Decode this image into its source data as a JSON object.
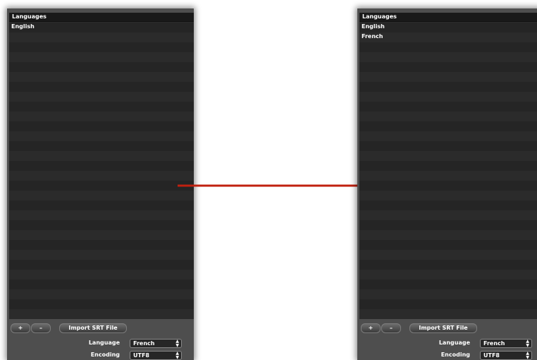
{
  "before": {
    "list_header": "Languages",
    "languages": [
      "English"
    ],
    "add_label": "+",
    "remove_label": "–",
    "import_label": "Import SRT File",
    "language_label": "Language",
    "language_value": "French",
    "encoding_label": "Encoding",
    "encoding_value": "UTF8"
  },
  "after": {
    "list_header": "Languages",
    "languages": [
      "English",
      "French"
    ],
    "add_label": "+",
    "remove_label": "–",
    "import_label": "Import SRT File",
    "language_label": "Language",
    "language_value": "French",
    "encoding_label": "Encoding",
    "encoding_value": "UTF8"
  },
  "colors": {
    "arrow": "#c0200f",
    "panel_bg": "#4e4e4e",
    "list_bg": "#2a2a2a"
  },
  "icons": {
    "arrow": "right-arrow-icon",
    "select_arrows": "up-down-chevron-icon"
  }
}
